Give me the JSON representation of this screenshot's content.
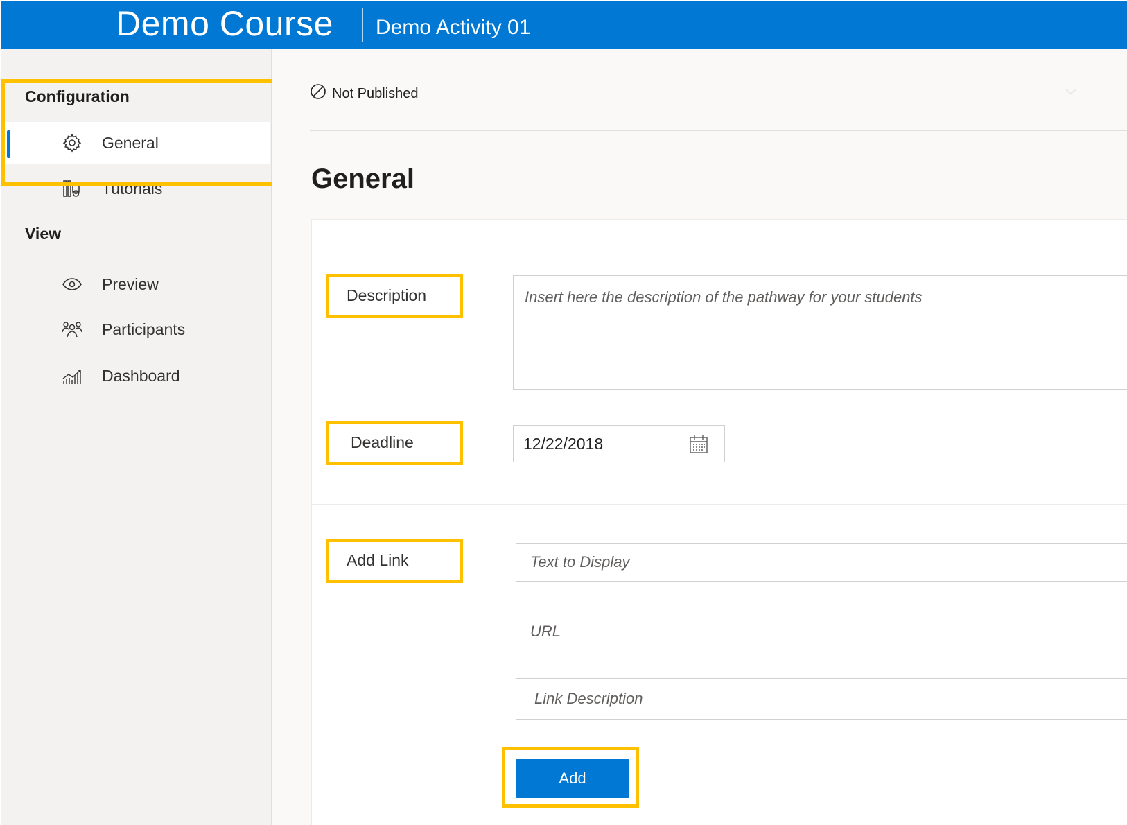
{
  "header": {
    "course_title": "Demo Course",
    "activity_title": "Demo Activity 01"
  },
  "sidebar": {
    "groups": [
      {
        "label": "Configuration",
        "items": [
          {
            "label": "General",
            "icon": "gear-icon",
            "active": true
          },
          {
            "label": "Tutorials",
            "icon": "tutorials-icon",
            "active": false
          }
        ]
      },
      {
        "label": "View",
        "items": [
          {
            "label": "Preview",
            "icon": "eye-icon",
            "active": false
          },
          {
            "label": "Participants",
            "icon": "participants-icon",
            "active": false
          },
          {
            "label": "Dashboard",
            "icon": "dashboard-chart-icon",
            "active": false
          }
        ]
      }
    ]
  },
  "main": {
    "status": {
      "label": "Not Published",
      "icon": "not-published-icon"
    },
    "title": "General",
    "form": {
      "description": {
        "label": "Description",
        "placeholder": "Insert here the description of the pathway for your students"
      },
      "deadline": {
        "label": "Deadline",
        "value": "12/22/2018"
      },
      "add_link": {
        "label": "Add Link",
        "text_placeholder": "Text to Display",
        "url_placeholder": "URL",
        "desc_placeholder": "Link Description",
        "button_label": "Add"
      }
    }
  },
  "colors": {
    "accent": "#0078d4",
    "highlight": "#ffc000",
    "sidebar_bg": "#f3f2f1"
  }
}
